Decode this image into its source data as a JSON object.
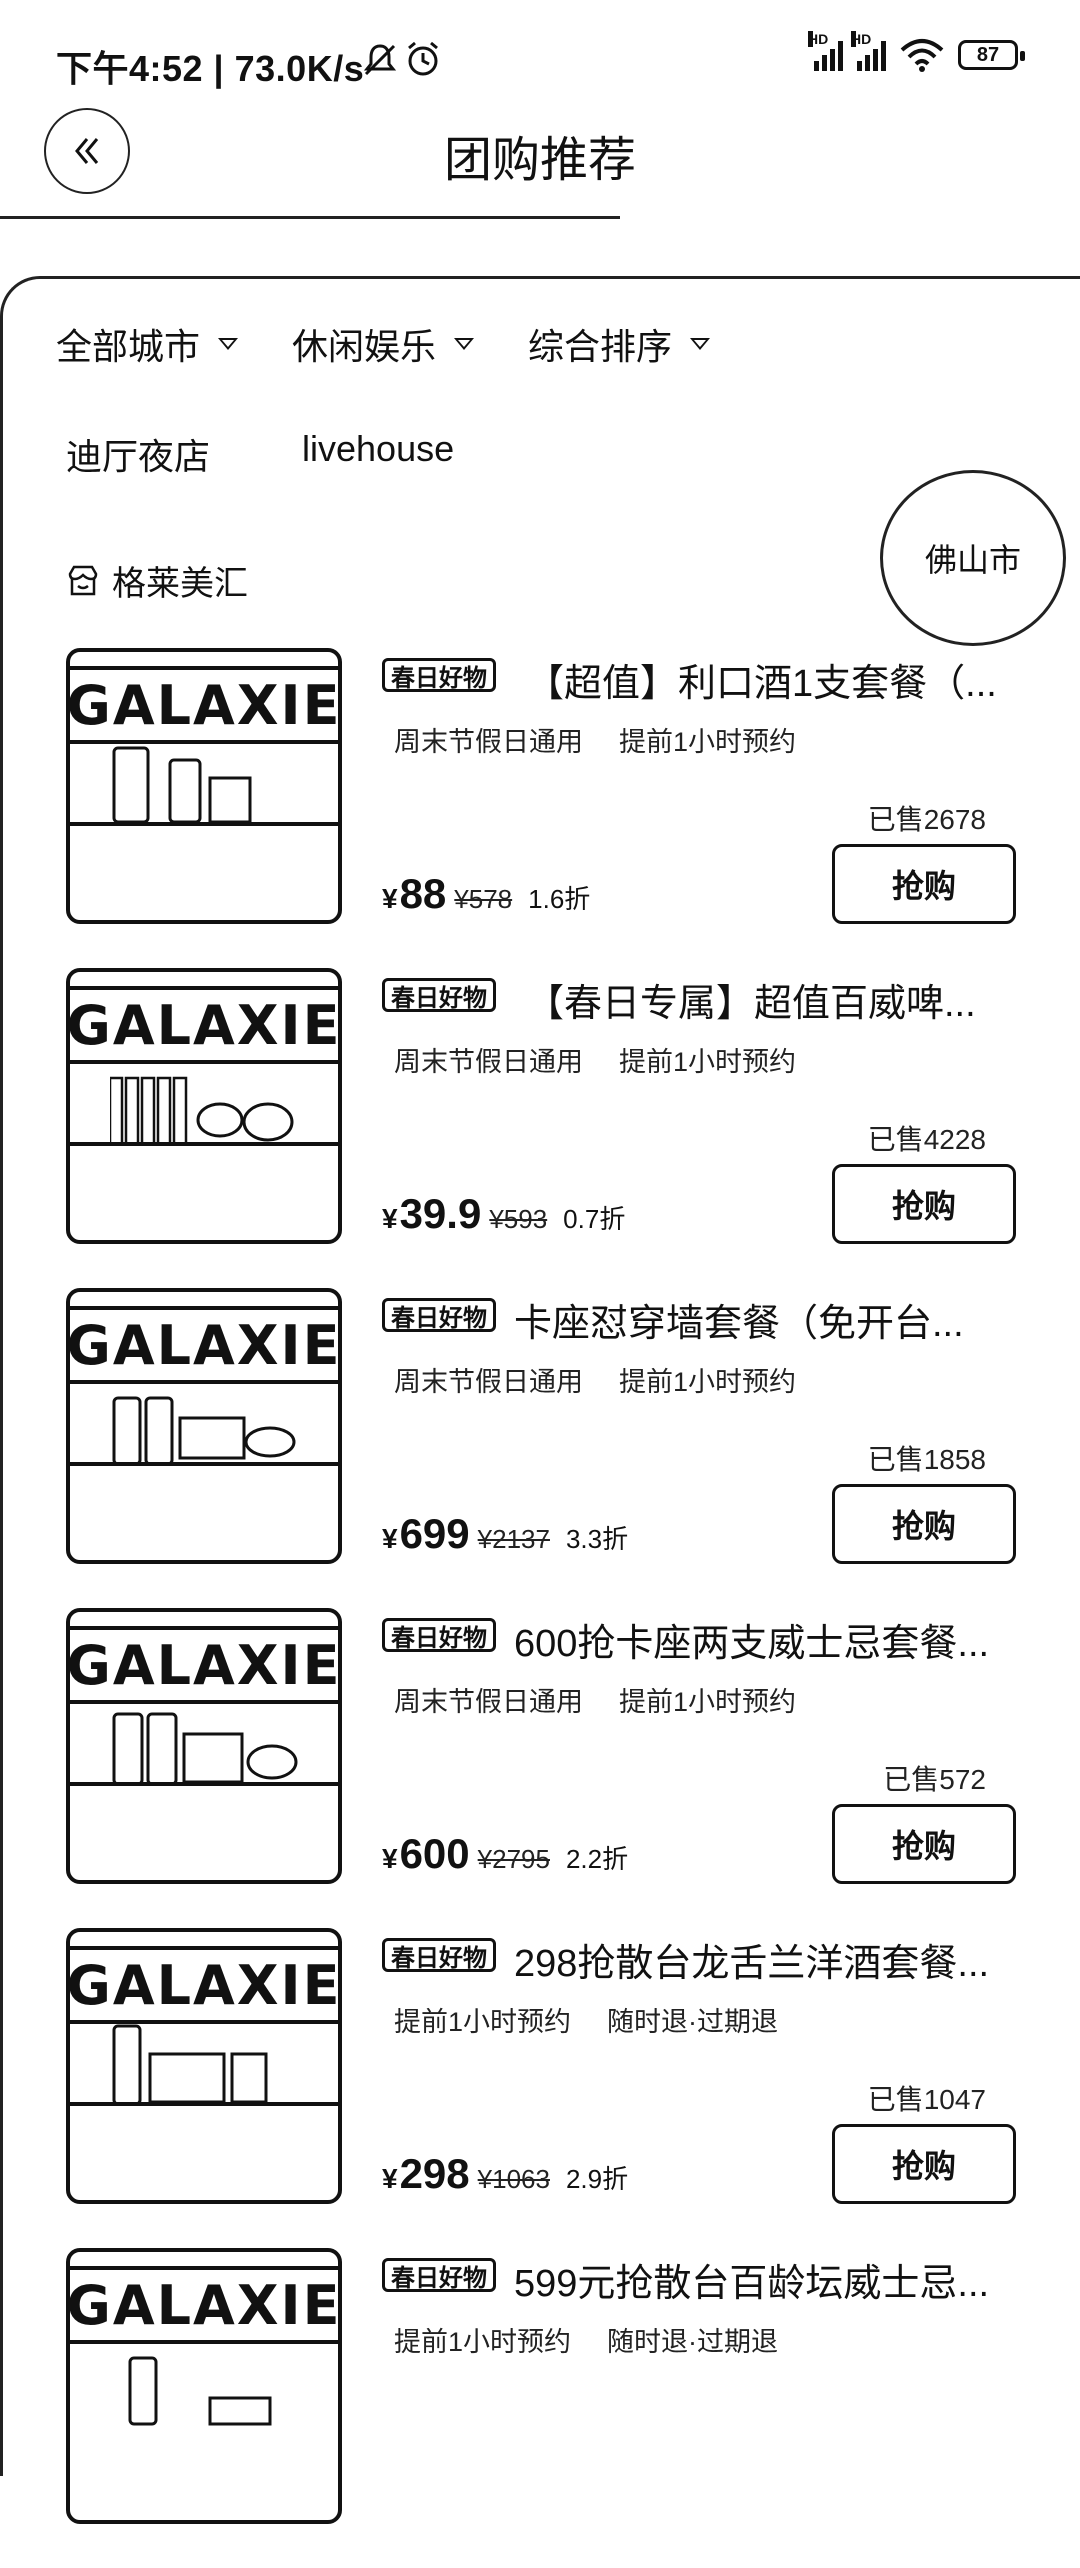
{
  "status_bar": {
    "time": "下午4:52 | 73.0K/s",
    "battery": "87",
    "icons": [
      "mute-icon",
      "alarm-icon",
      "signal-icon",
      "signal-icon",
      "wifi-icon",
      "battery-icon"
    ]
  },
  "header": {
    "title": "团购推荐"
  },
  "filters": [
    {
      "label": "全部城市"
    },
    {
      "label": "休闲娱乐"
    },
    {
      "label": "综合排序"
    }
  ],
  "categories": [
    "迪厅夜店",
    "livehouse"
  ],
  "venue": {
    "name": "格莱美汇",
    "city": "佛山市"
  },
  "products": [
    {
      "tag": "春日好物",
      "title": "【超值】利口酒1支套餐（...",
      "features": [
        "周末节假日通用",
        "提前1小时预约"
      ],
      "sold": "已售2678",
      "yen": "¥",
      "price": "88",
      "original": "¥578",
      "discount": "1.6折",
      "buy": "抢购"
    },
    {
      "tag": "春日好物",
      "title": "【春日专属】超值百威啤...",
      "features": [
        "周末节假日通用",
        "提前1小时预约"
      ],
      "sold": "已售4228",
      "yen": "¥",
      "price": "39.9",
      "original": "¥593",
      "discount": "0.7折",
      "buy": "抢购"
    },
    {
      "tag": "春日好物",
      "title": "卡座怼穿墙套餐（免开台...",
      "features": [
        "周末节假日通用",
        "提前1小时预约"
      ],
      "sold": "已售1858",
      "yen": "¥",
      "price": "699",
      "original": "¥2137",
      "discount": "3.3折",
      "buy": "抢购"
    },
    {
      "tag": "春日好物",
      "title": "600抢卡座两支威士忌套餐...",
      "features": [
        "周末节假日通用",
        "提前1小时预约"
      ],
      "sold": "已售572",
      "yen": "¥",
      "price": "600",
      "original": "¥2795",
      "discount": "2.2折",
      "buy": "抢购"
    },
    {
      "tag": "春日好物",
      "title": "298抢散台龙舌兰洋酒套餐...",
      "features": [
        "提前1小时预约",
        "随时退·过期退"
      ],
      "sold": "已售1047",
      "yen": "¥",
      "price": "298",
      "original": "¥1063",
      "discount": "2.9折",
      "buy": "抢购"
    },
    {
      "tag": "春日好物",
      "title": "599元抢散台百龄坛威士忌...",
      "features": [
        "提前1小时预约",
        "随时退·过期退"
      ]
    }
  ],
  "thumb_brand": "GALAXIE"
}
